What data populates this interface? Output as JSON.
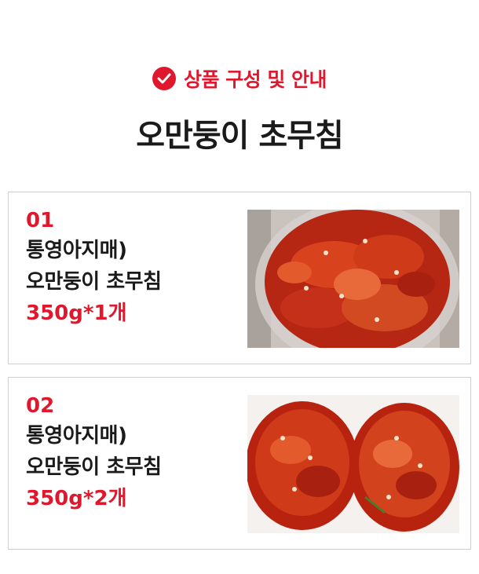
{
  "header": {
    "badge_icon": "check-circle-icon",
    "subtitle": "상품 구성 및 안내",
    "title": "오만둥이 초무침"
  },
  "items": [
    {
      "number": "01",
      "line1": "통영아지매)",
      "line2": "오만둥이 초무침",
      "quantity": "350g*1개",
      "photo": "single-jar-kimchi-photo"
    },
    {
      "number": "02",
      "line1": "통영아지매)",
      "line2": "오만둥이 초무침",
      "quantity": "350g*2개",
      "photo": "two-jars-kimchi-photo"
    }
  ],
  "colors": {
    "accent": "#e0182d",
    "text": "#1a1a1a",
    "border": "#cfcfcf"
  }
}
